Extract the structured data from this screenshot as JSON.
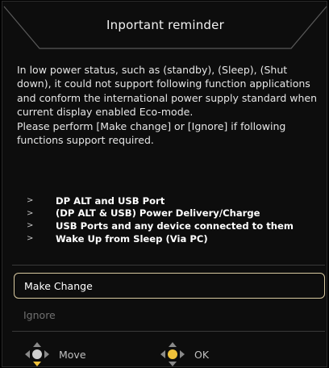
{
  "dialog": {
    "title": "Inportant reminder",
    "paragraph1": "In low power status, such as (standby), (Sleep), (Shut down), it could not support following function applications and conform the international power supply standard when current display enabled Eco-mode.",
    "paragraph2": "Please perform [Make change] or [Ignore] if following functions support required.",
    "features": [
      "DP ALT and USB Port",
      "(DP ALT & USB) Power Delivery/Charge",
      "USB Ports and any device connected to them",
      "Wake Up from Sleep (Via PC)"
    ]
  },
  "options": {
    "make_change": "Make Change",
    "ignore": "Ignore"
  },
  "footer": {
    "move_label": "Move",
    "ok_label": "OK"
  },
  "colors": {
    "accent": "#f0c23a",
    "selected_border": "#d8c9a0",
    "dim_text": "#707070"
  },
  "icons": {
    "bullet": "chevron-right-icon",
    "move": "joystick-move-icon",
    "ok": "joystick-press-icon"
  }
}
